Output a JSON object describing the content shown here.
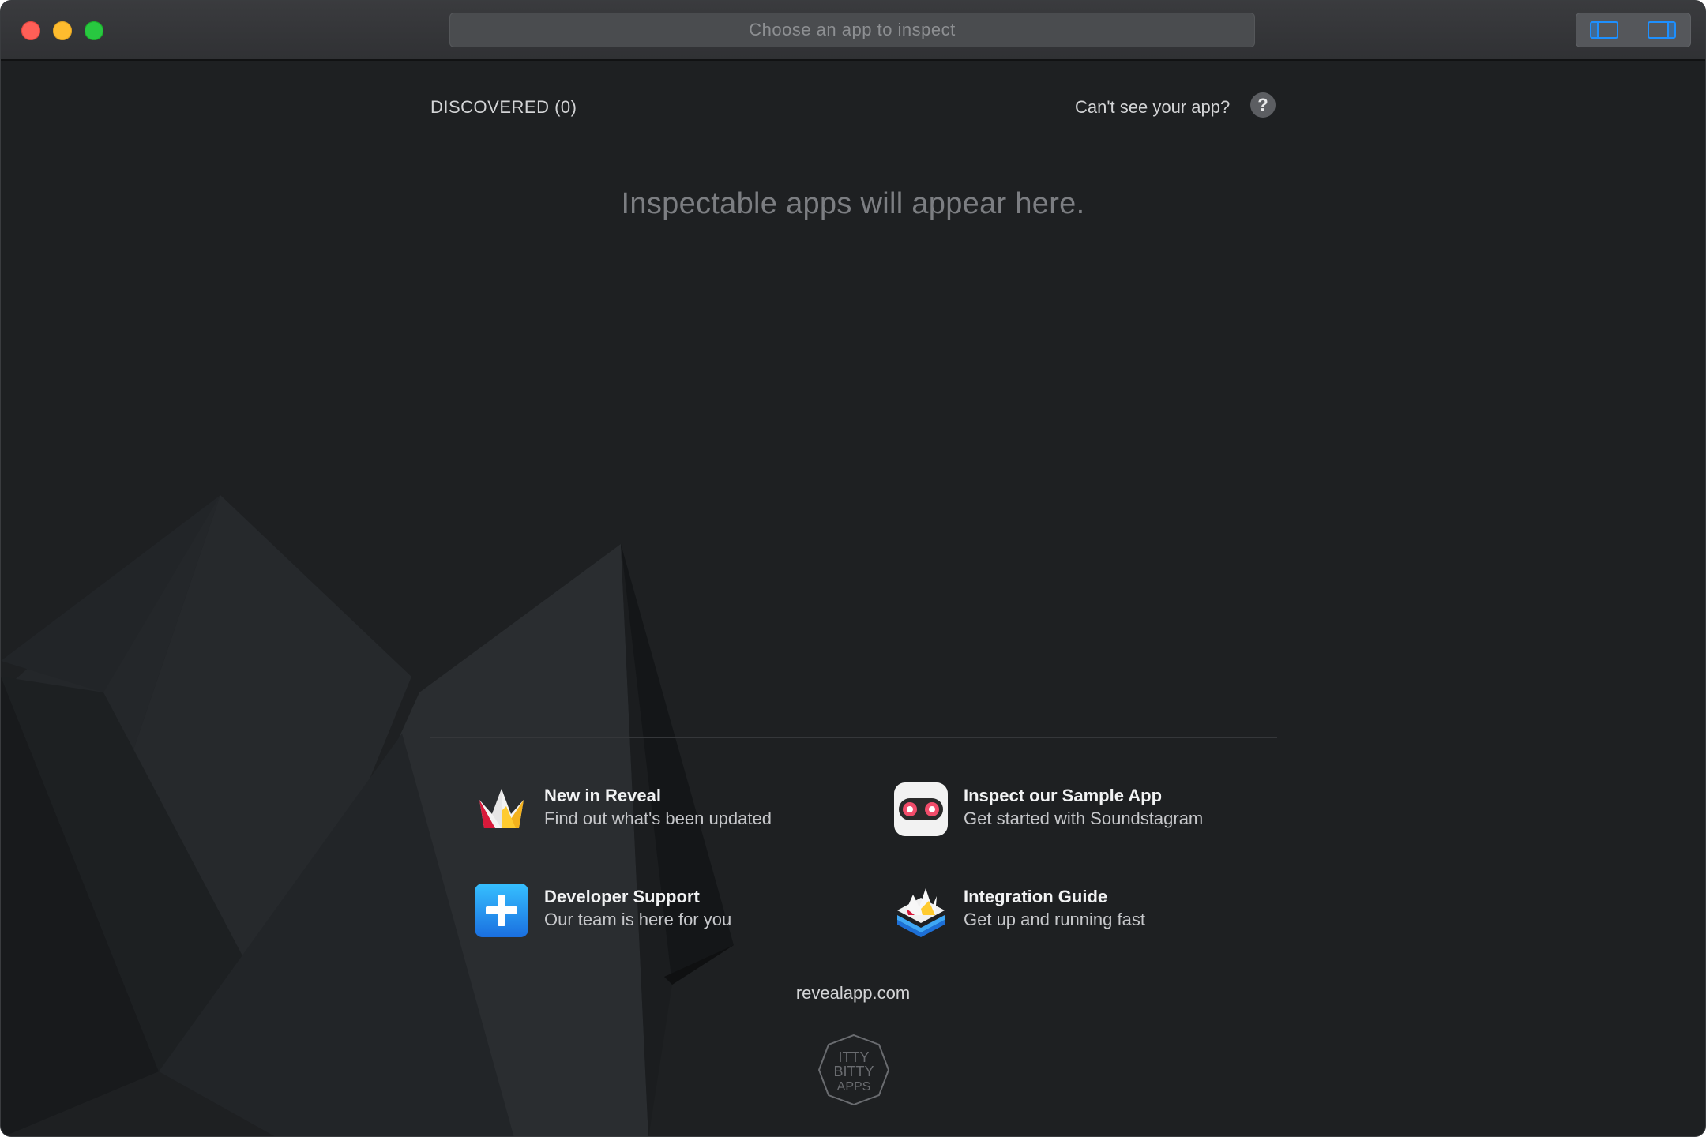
{
  "window": {
    "traffic_lights": [
      "close",
      "minimize",
      "zoom"
    ],
    "chooser_placeholder": "Choose an app to inspect",
    "view_toggle": [
      "sidebar-left-icon",
      "sidebar-right-icon"
    ]
  },
  "discovered": {
    "label": "DISCOVERED (0)"
  },
  "help": {
    "label": "Can't see your app?",
    "icon_glyph": "?"
  },
  "empty_state": "Inspectable apps will appear here.",
  "links": [
    {
      "title": "New in Reveal",
      "subtitle": "Find out what's been updated",
      "icon": "reveal-crown-icon"
    },
    {
      "title": "Inspect our Sample App",
      "subtitle": "Get started with Soundstagram",
      "icon": "soundstagram-icon"
    },
    {
      "title": "Developer Support",
      "subtitle": "Our team is here for you",
      "icon": "support-plus-icon"
    },
    {
      "title": "Integration Guide",
      "subtitle": "Get up and running fast",
      "icon": "integration-stack-icon"
    }
  ],
  "footer": {
    "site": "revealapp.com",
    "logo_text": "ITTY BITTY APPS"
  },
  "colors": {
    "background": "#1e2022",
    "titlebar": "#34363a",
    "accent_blue": "#1e90ff"
  }
}
